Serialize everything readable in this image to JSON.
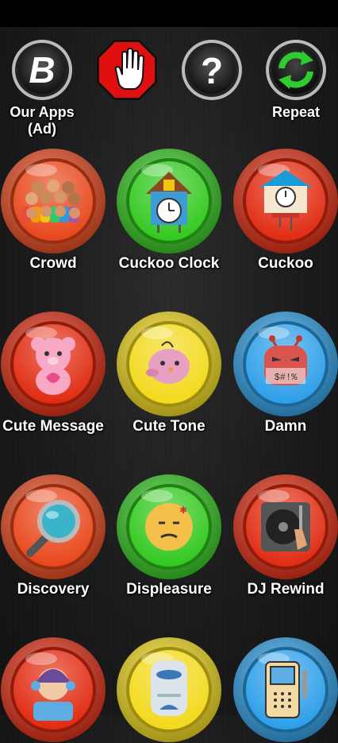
{
  "toolbar": {
    "our_apps_label": "Our Apps\n(Ad)",
    "repeat_label": "Repeat"
  },
  "sounds": [
    {
      "label": "Crowd",
      "color": "#e8461a",
      "icon": "crowd-icon"
    },
    {
      "label": "Cuckoo Clock",
      "color": "#32c81e",
      "icon": "cuckoo-clock-icon"
    },
    {
      "label": "Cuckoo",
      "color": "#e02a10",
      "icon": "cuckoo-house-icon"
    },
    {
      "label": "Cute Message",
      "color": "#e02a10",
      "icon": "teddy-bear-icon"
    },
    {
      "label": "Cute Tone",
      "color": "#f2d91a",
      "icon": "cute-bird-icon"
    },
    {
      "label": "Damn",
      "color": "#2c9ee8",
      "icon": "angry-face-icon"
    },
    {
      "label": "Discovery",
      "color": "#e8461a",
      "icon": "magnifier-icon"
    },
    {
      "label": "Displeasure",
      "color": "#32c81e",
      "icon": "displeased-face-icon"
    },
    {
      "label": "DJ Rewind",
      "color": "#e02a10",
      "icon": "turntable-icon"
    },
    {
      "label": "",
      "color": "#e02a10",
      "icon": "dj-girl-icon"
    },
    {
      "label": "",
      "color": "#f2d91a",
      "icon": "smart-speaker-icon"
    },
    {
      "label": "",
      "color": "#2c9ee8",
      "icon": "handheld-device-icon"
    }
  ]
}
